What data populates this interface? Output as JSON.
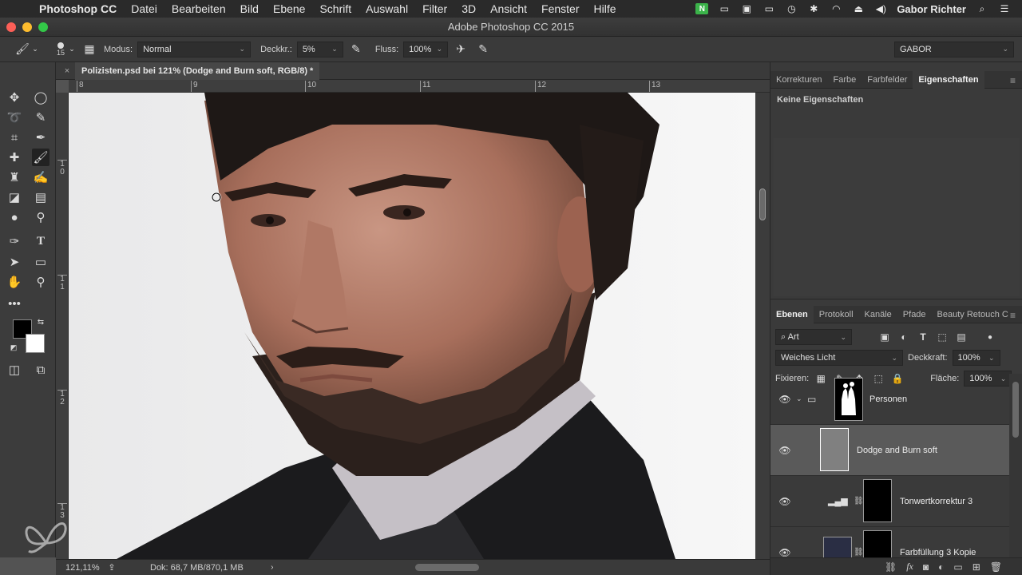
{
  "menubar": {
    "app": "Photoshop CC",
    "items": [
      "Datei",
      "Bearbeiten",
      "Bild",
      "Ebene",
      "Schrift",
      "Auswahl",
      "Filter",
      "3D",
      "Ansicht",
      "Fenster",
      "Hilfe"
    ],
    "user": "Gabor Richter"
  },
  "window": {
    "title": "Adobe Photoshop CC 2015"
  },
  "options": {
    "brush_size": "15",
    "mode_label": "Modus:",
    "mode_value": "Normal",
    "opacity_label": "Deckkr.:",
    "opacity_value": "5%",
    "flow_label": "Fluss:",
    "flow_value": "100%",
    "workspace": "GABOR"
  },
  "document": {
    "tab_title": "Polizisten.psd bei 121% (Dodge and Burn soft, RGB/8) *",
    "ruler_h": [
      "8",
      "9",
      "10",
      "11",
      "12",
      "13"
    ],
    "ruler_v": [
      "1 0",
      "1 1",
      "1 2",
      "1 3"
    ]
  },
  "status": {
    "zoom": "121,11%",
    "doc": "Dok: 68,7 MB/870,1 MB"
  },
  "properties": {
    "tabs": [
      "Korrekturen",
      "Farbe",
      "Farbfelder",
      "Eigenschaften"
    ],
    "active_tab": "Eigenschaften",
    "body": "Keine Eigenschaften"
  },
  "layers_panel": {
    "tabs": [
      "Ebenen",
      "Protokoll",
      "Kanäle",
      "Pfade",
      "Beauty Retouch C"
    ],
    "filter_value": "Art",
    "blend_mode": "Weiches Licht",
    "opacity_label": "Deckkraft:",
    "opacity_value": "100%",
    "lock_label": "Fixieren:",
    "fill_label": "Fläche:",
    "fill_value": "100%",
    "layers": [
      {
        "name": "Personen",
        "type": "group"
      },
      {
        "name": "Dodge and Burn soft",
        "type": "pixel",
        "selected": true
      },
      {
        "name": "Tonwertkorrektur 3",
        "type": "adjustment"
      },
      {
        "name": "Farbfüllung 3 Kopie",
        "type": "fill"
      }
    ]
  },
  "icons": {
    "toolbar": [
      "move-icon",
      "ellipse-marquee-icon",
      "lasso-icon",
      "quick-select-icon",
      "crop-icon",
      "eyedropper-icon",
      "healing-brush-icon",
      "brush-icon",
      "stamp-icon",
      "history-brush-icon",
      "eraser-icon",
      "gradient-icon",
      "blur-icon",
      "dodge-icon",
      "pen-icon",
      "type-icon",
      "path-select-icon",
      "rectangle-icon",
      "hand-icon",
      "zoom-icon",
      "more-icon"
    ]
  }
}
